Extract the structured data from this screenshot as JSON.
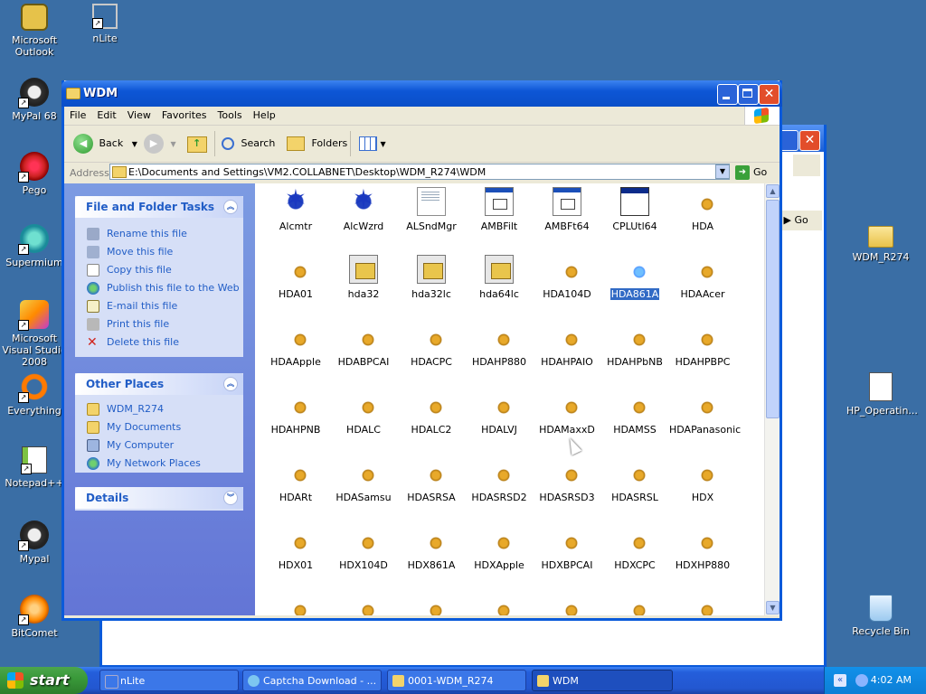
{
  "desktop": {
    "icons": [
      {
        "label": "Microsoft Outlook",
        "icon": "outlook-icon"
      },
      {
        "label": "nLite",
        "icon": "nlite-icon"
      },
      {
        "label": "MyPal 68",
        "icon": "mypal-icon"
      },
      {
        "label": "Pego",
        "icon": "pego-icon"
      },
      {
        "label": "Supermium",
        "icon": "supermium-icon"
      },
      {
        "label": "Microsoft Visual Studio 2008",
        "icon": "visual-studio-icon"
      },
      {
        "label": "Everything",
        "icon": "everything-icon"
      },
      {
        "label": "Notepad++",
        "icon": "notepadpp-icon"
      },
      {
        "label": "Mypal",
        "icon": "mypal-icon"
      },
      {
        "label": "BitComet",
        "icon": "bitcomet-icon"
      },
      {
        "label": "WDM_R274",
        "icon": "folder-icon"
      },
      {
        "label": "HP_Operatin...",
        "icon": "document-icon"
      },
      {
        "label": "Recycle Bin",
        "icon": "recycle-bin-icon"
      }
    ]
  },
  "background_window": {
    "go_label": "Go"
  },
  "window": {
    "title": "WDM",
    "menu": [
      "File",
      "Edit",
      "View",
      "Favorites",
      "Tools",
      "Help"
    ],
    "toolbar": {
      "back_label": "Back",
      "search_label": "Search",
      "folders_label": "Folders"
    },
    "address": {
      "label": "Address",
      "value": "E:\\Documents and Settings\\VM2.COLLABNET\\Desktop\\WDM_R274\\WDM",
      "go_label": "Go"
    },
    "tasks_panel": {
      "title": "File and Folder Tasks",
      "items": [
        "Rename this file",
        "Move this file",
        "Copy this file",
        "Publish this file to the Web",
        "E-mail this file",
        "Print this file",
        "Delete this file"
      ]
    },
    "places_panel": {
      "title": "Other Places",
      "items": [
        "WDM_R274",
        "My Documents",
        "My Computer",
        "My Network Places"
      ]
    },
    "details_panel": {
      "title": "Details"
    },
    "files": [
      {
        "name": "Alcmtr",
        "type": "crab"
      },
      {
        "name": "AlcWzrd",
        "type": "crab"
      },
      {
        "name": "ALSndMgr",
        "type": "page"
      },
      {
        "name": "AMBFilt",
        "type": "exe"
      },
      {
        "name": "AMBFt64",
        "type": "exe"
      },
      {
        "name": "CPLUtl64",
        "type": "cpl"
      },
      {
        "name": "HDA",
        "type": "inf"
      },
      {
        "name": "HDA01",
        "type": "inf"
      },
      {
        "name": "hda32",
        "type": "sysf"
      },
      {
        "name": "hda32lc",
        "type": "sysf"
      },
      {
        "name": "hda64lc",
        "type": "sysf"
      },
      {
        "name": "HDA104D",
        "type": "inf"
      },
      {
        "name": "HDA861A",
        "type": "inf",
        "selected": true
      },
      {
        "name": "HDAAcer",
        "type": "inf"
      },
      {
        "name": "HDAApple",
        "type": "inf"
      },
      {
        "name": "HDABPCAI",
        "type": "inf"
      },
      {
        "name": "HDACPC",
        "type": "inf"
      },
      {
        "name": "HDAHP880",
        "type": "inf"
      },
      {
        "name": "HDAHPAIO",
        "type": "inf"
      },
      {
        "name": "HDAHPbNB",
        "type": "inf"
      },
      {
        "name": "HDAHPBPC",
        "type": "inf"
      },
      {
        "name": "HDAHPNB",
        "type": "inf"
      },
      {
        "name": "HDALC",
        "type": "inf"
      },
      {
        "name": "HDALC2",
        "type": "inf"
      },
      {
        "name": "HDALVJ",
        "type": "inf"
      },
      {
        "name": "HDAMaxxD",
        "type": "inf"
      },
      {
        "name": "HDAMSS",
        "type": "inf"
      },
      {
        "name": "HDAPanasonic",
        "type": "inf"
      },
      {
        "name": "HDARt",
        "type": "inf"
      },
      {
        "name": "HDASamsu",
        "type": "inf"
      },
      {
        "name": "HDASRSA",
        "type": "inf"
      },
      {
        "name": "HDASRSD2",
        "type": "inf"
      },
      {
        "name": "HDASRSD3",
        "type": "inf"
      },
      {
        "name": "HDASRSL",
        "type": "inf"
      },
      {
        "name": "HDX",
        "type": "inf"
      },
      {
        "name": "HDX01",
        "type": "inf"
      },
      {
        "name": "HDX104D",
        "type": "inf"
      },
      {
        "name": "HDX861A",
        "type": "inf"
      },
      {
        "name": "HDXApple",
        "type": "inf"
      },
      {
        "name": "HDXBPCAI",
        "type": "inf"
      },
      {
        "name": "HDXCPC",
        "type": "inf"
      },
      {
        "name": "HDXHP880",
        "type": "inf"
      },
      {
        "name": "",
        "type": "inf"
      },
      {
        "name": "",
        "type": "inf"
      },
      {
        "name": "",
        "type": "inf"
      },
      {
        "name": "",
        "type": "inf"
      },
      {
        "name": "",
        "type": "inf"
      },
      {
        "name": "",
        "type": "inf"
      },
      {
        "name": "",
        "type": "inf"
      }
    ]
  },
  "taskbar": {
    "start_label": "start",
    "tasks": [
      {
        "label": "nLite",
        "active": false
      },
      {
        "label": "Captcha Download - ...",
        "active": false
      },
      {
        "label": "0001-WDM_R274",
        "active": false
      },
      {
        "label": "WDM",
        "active": true
      }
    ],
    "clock": "4:02 AM"
  },
  "colors": {
    "desktop": "#3a6ea5",
    "titlebar": "#0a5ada",
    "selection": "#316ac5",
    "link": "#215dc6"
  }
}
